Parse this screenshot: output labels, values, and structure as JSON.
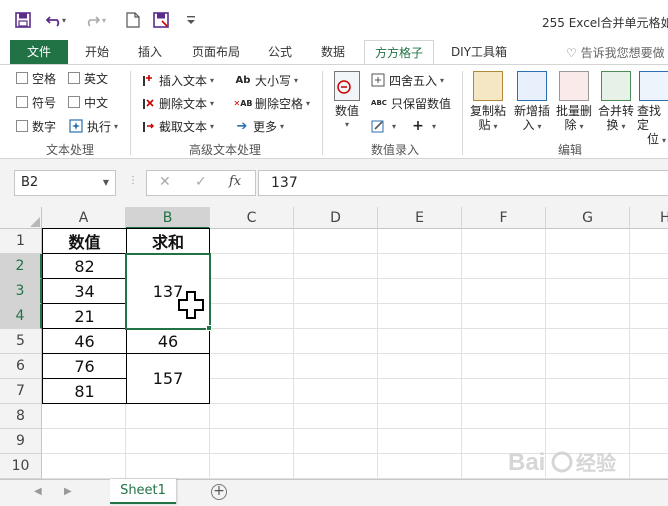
{
  "window": {
    "title": "255 Excel合并单元格如"
  },
  "ribbon_tabs": [
    "文件",
    "开始",
    "插入",
    "页面布局",
    "公式",
    "数据",
    "方方格子",
    "DIY工具箱"
  ],
  "active_tab": "方方格子",
  "tell_me": "告诉我您想要做",
  "ribbon": {
    "text_processing": {
      "checkboxes": [
        "空格",
        "英文",
        "符号",
        "中文",
        "数字"
      ],
      "execute": "执行",
      "label": "文本处理"
    },
    "advanced_text": {
      "insert_text": "插入文本",
      "delete_text": "删除文本",
      "extract_text": "截取文本",
      "case": "大小写",
      "delete_spaces": "删除空格",
      "more": "更多",
      "label": "高级文本处理"
    },
    "numeric_entry": {
      "numeric": "数值",
      "round": "四舍五入",
      "keep_value": "只保留数值",
      "label": "数值录入"
    },
    "edit": {
      "copy_paste": [
        "复制粘",
        "贴"
      ],
      "new_insert": [
        "新增插",
        "入"
      ],
      "batch_delete": [
        "批量删",
        "除"
      ],
      "merge_convert": [
        "合并转",
        "换"
      ],
      "find_locate": [
        "查找定",
        "位"
      ],
      "label": "编辑"
    }
  },
  "formula_bar": {
    "name_box": "B2",
    "formula": "137"
  },
  "columns": [
    "A",
    "B",
    "C",
    "D",
    "E",
    "F",
    "G",
    "H"
  ],
  "rows": [
    "1",
    "2",
    "3",
    "4",
    "5",
    "6",
    "7",
    "8",
    "9",
    "10"
  ],
  "sheet": {
    "header_a": "数值",
    "header_b": "求和",
    "a_values": [
      "82",
      "34",
      "21",
      "46",
      "76",
      "81"
    ],
    "b_values": [
      "137",
      "46",
      "157"
    ]
  },
  "sheet_tabs": [
    "Sheet1"
  ],
  "colors": {
    "accent": "#217346",
    "selected_header": "#d3d3d3"
  }
}
